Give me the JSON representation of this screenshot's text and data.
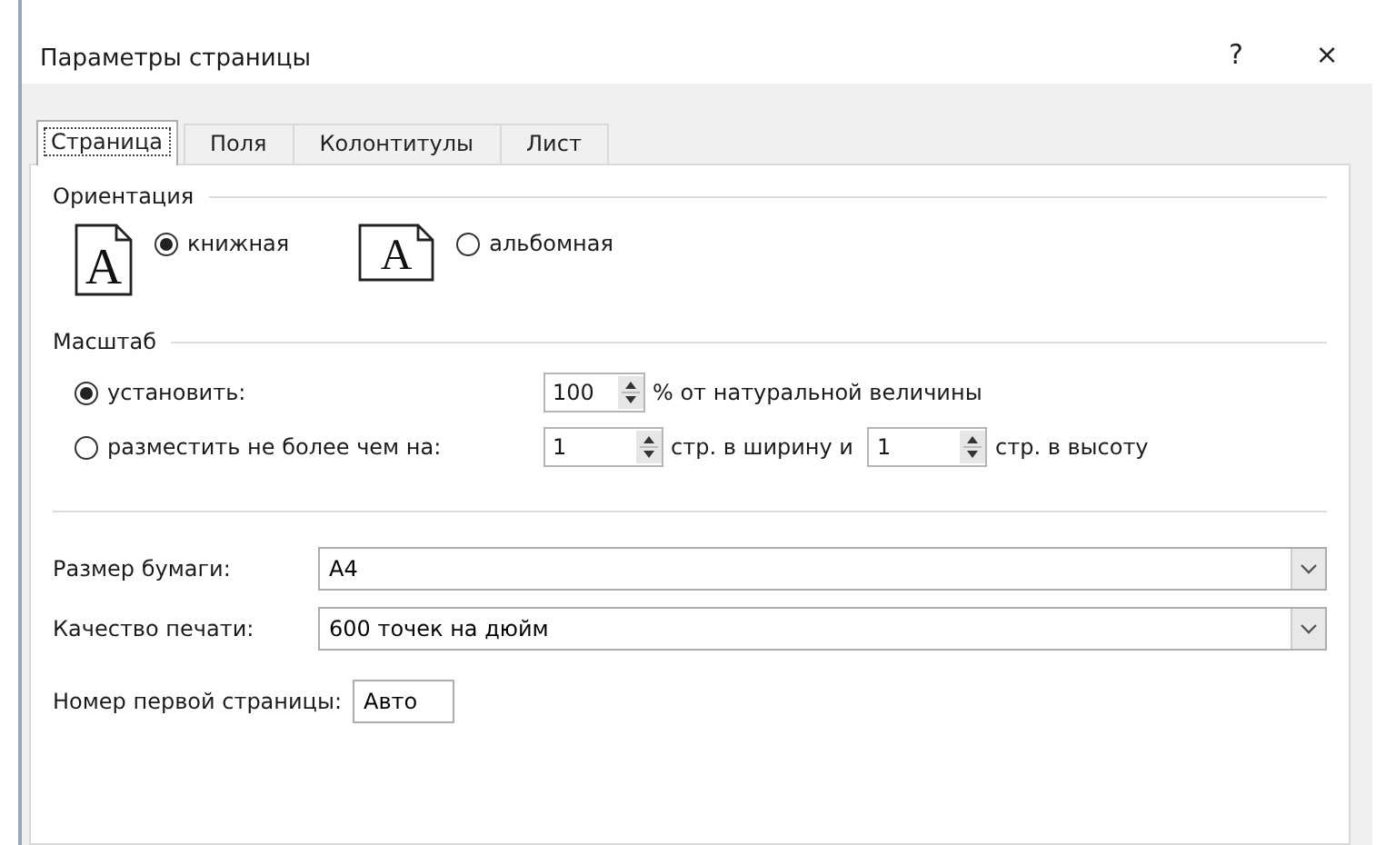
{
  "window": {
    "title": "Параметры страницы",
    "help": "?",
    "close": "×"
  },
  "tabs": [
    {
      "label": "Страница",
      "selected": true
    },
    {
      "label": "Поля",
      "selected": false
    },
    {
      "label": "Колонтитулы",
      "selected": false
    },
    {
      "label": "Лист",
      "selected": false
    }
  ],
  "orientation": {
    "title": "Ориентация",
    "options": [
      {
        "label": "книжная",
        "selected": true,
        "kind": "portrait",
        "icon_letter": "A"
      },
      {
        "label": "альбомная",
        "selected": false,
        "kind": "landscape",
        "icon_letter": "A"
      }
    ]
  },
  "scale": {
    "title": "Масштаб",
    "options": [
      {
        "label": "установить:",
        "selected": true,
        "fields": [
          {
            "value": "100",
            "after": "% от натуральной величины"
          }
        ]
      },
      {
        "label": "разместить не более чем на:",
        "selected": false,
        "fields": [
          {
            "value": "1",
            "after": "стр. в ширину и"
          },
          {
            "value": "1",
            "after": "стр. в высоту"
          }
        ]
      }
    ]
  },
  "paper_size": {
    "label": "Размер бумаги:",
    "value": "A4"
  },
  "print_quality": {
    "label": "Качество печати:",
    "value": "600 точек на дюйм"
  },
  "first_page_number": {
    "label": "Номер первой страницы:",
    "value": "Авто"
  }
}
